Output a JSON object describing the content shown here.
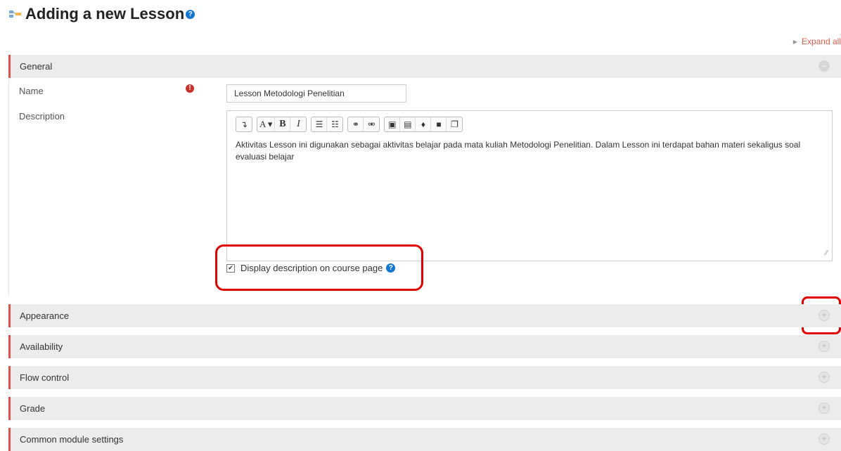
{
  "page": {
    "title": "Adding a new Lesson",
    "expand_all": "Expand all"
  },
  "general": {
    "header": "General",
    "name_label": "Name",
    "name_value": "Lesson Metodologi Penelitian",
    "description_label": "Description",
    "description_text": "Aktivitas Lesson ini digunakan sebagai aktivitas belajar pada mata kuliah Metodologi Penelitian. Dalam Lesson ini terdapat bahan materi sekaligus soal evaluasi belajar",
    "display_description_label": "Display description on course page",
    "display_description_checked": true
  },
  "toolbar": {
    "groups": [
      [
        {
          "icon": "toolbar-toggle-icon",
          "glyph": "↴"
        }
      ],
      [
        {
          "icon": "font-style-icon",
          "glyph": "A ▾"
        },
        {
          "icon": "bold-icon",
          "glyph": "B"
        },
        {
          "icon": "italic-icon",
          "glyph": "I"
        }
      ],
      [
        {
          "icon": "unordered-list-icon",
          "glyph": "☰"
        },
        {
          "icon": "ordered-list-icon",
          "glyph": "☷"
        }
      ],
      [
        {
          "icon": "link-icon",
          "glyph": "⚭"
        },
        {
          "icon": "unlink-icon",
          "glyph": "⚮"
        }
      ],
      [
        {
          "icon": "image-icon",
          "glyph": "▣"
        },
        {
          "icon": "media-icon",
          "glyph": "▤"
        },
        {
          "icon": "audio-record-icon",
          "glyph": "♦"
        },
        {
          "icon": "video-record-icon",
          "glyph": "■"
        },
        {
          "icon": "manage-files-icon",
          "glyph": "❐"
        }
      ]
    ]
  },
  "sections": [
    {
      "label": "Appearance"
    },
    {
      "label": "Availability"
    },
    {
      "label": "Flow control"
    },
    {
      "label": "Grade"
    },
    {
      "label": "Common module settings"
    }
  ],
  "colors": {
    "accent": "#d9534f",
    "highlight": "#e00000",
    "help": "#1177d1"
  }
}
